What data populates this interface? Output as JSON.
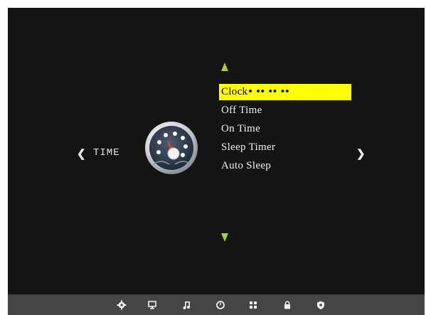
{
  "category": {
    "label": "TIME",
    "prev_glyph": "❮",
    "next_glyph": "❯",
    "icon": "clock-gauge-icon"
  },
  "menu": {
    "items": [
      {
        "label": "Clock",
        "value": "• ••  ••  ••",
        "selected": true
      },
      {
        "label": "Off Time",
        "value": "",
        "selected": false
      },
      {
        "label": "On Time",
        "value": "",
        "selected": false
      },
      {
        "label": "Sleep Timer",
        "value": "",
        "selected": false
      },
      {
        "label": "Auto Sleep",
        "value": "",
        "selected": false
      }
    ]
  },
  "bottom_bar": {
    "icons": [
      "settings-icon",
      "monitor-icon",
      "music-note-icon",
      "clock-icon",
      "grid-icon",
      "lock-icon",
      "shield-icon"
    ]
  },
  "colors": {
    "highlight": "#ffff00",
    "arrow": "#a8cc3a",
    "background": "#141414",
    "bar": "#454545"
  }
}
